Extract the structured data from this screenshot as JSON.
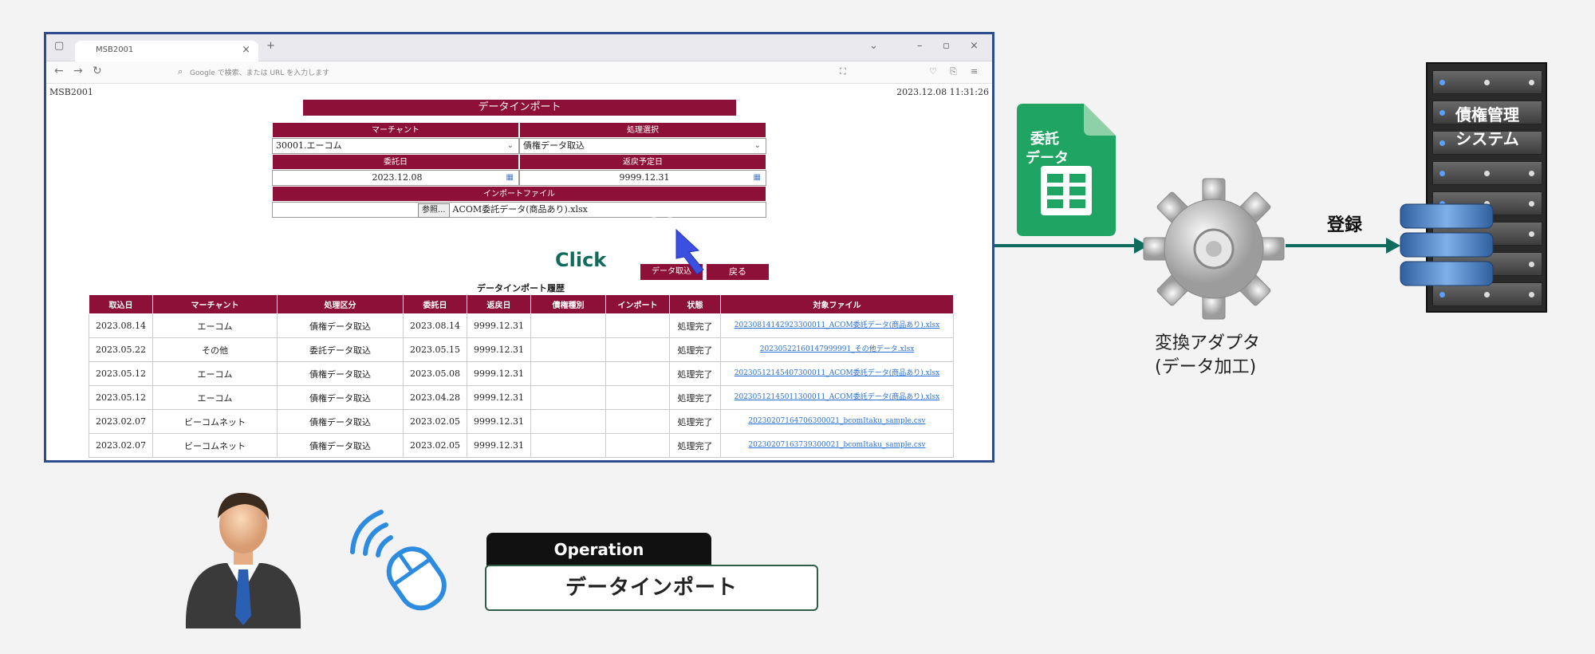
{
  "browser": {
    "tab_title": "MSB2001",
    "url_placeholder": "Google で検索、または URL を入力します"
  },
  "page": {
    "id": "MSB2001",
    "datetime": "2023.12.08 11:31:26",
    "title": "データインポート"
  },
  "form": {
    "merchant_label": "マーチャント",
    "merchant_value": "30001.エーコム",
    "process_label": "処理選択",
    "process_value": "債権データ取込",
    "entrust_date_label": "委託日",
    "entrust_date_value": "2023.12.08",
    "return_date_label": "返戻予定日",
    "return_date_value": "9999.12.31",
    "import_file_label": "インポートファイル",
    "browse_label": "参照...",
    "file_name": "ACOM委託データ(商品あり).xlsx",
    "import_button": "データ取込",
    "back_button": "戻る"
  },
  "history": {
    "title": "データインポート履歴",
    "headers": [
      "取込日",
      "マーチャント",
      "処理区分",
      "委託日",
      "返戻日",
      "債権種別",
      "インポート",
      "状態",
      "対象ファイル"
    ],
    "rows": [
      [
        "2023.08.14",
        "エーコム",
        "債権データ取込",
        "2023.08.14",
        "9999.12.31",
        "",
        "",
        "処理完了",
        "20230814142923300011_ACOM委託データ(商品あり).xlsx"
      ],
      [
        "2023.05.22",
        "その他",
        "委託データ取込",
        "2023.05.15",
        "9999.12.31",
        "",
        "",
        "処理完了",
        "20230522160147999991_その他データ.xlsx"
      ],
      [
        "2023.05.12",
        "エーコム",
        "債権データ取込",
        "2023.05.08",
        "9999.12.31",
        "",
        "",
        "処理完了",
        "20230512145407300011_ACOM委託データ(商品あり).xlsx"
      ],
      [
        "2023.05.12",
        "エーコム",
        "債権データ取込",
        "2023.04.28",
        "9999.12.31",
        "",
        "",
        "処理完了",
        "20230512145011300011_ACOM委託データ(商品あり).xlsx"
      ],
      [
        "2023.02.07",
        "ビーコムネット",
        "債権データ取込",
        "2023.02.05",
        "9999.12.31",
        "",
        "",
        "処理完了",
        "20230207164706300021_bcomItaku_sample.csv"
      ],
      [
        "2023.02.07",
        "ビーコムネット",
        "債権データ取込",
        "2023.02.05",
        "9999.12.31",
        "",
        "",
        "処理完了",
        "20230207163739300021_bcomItaku_sample.csv"
      ]
    ]
  },
  "diagram": {
    "click_text": "Click",
    "sheet_label_1": "委託",
    "sheet_label_2": "データ",
    "adapter_line1": "変換アダプタ",
    "adapter_line2": "(データ加工)",
    "register_label": "登録",
    "system_line1": "債権管理",
    "system_line2": "システム",
    "operation_header": "Operation",
    "operation_name": "データインポート",
    "line_color": "#0f6b5b",
    "accent_color": "#8c1038"
  }
}
